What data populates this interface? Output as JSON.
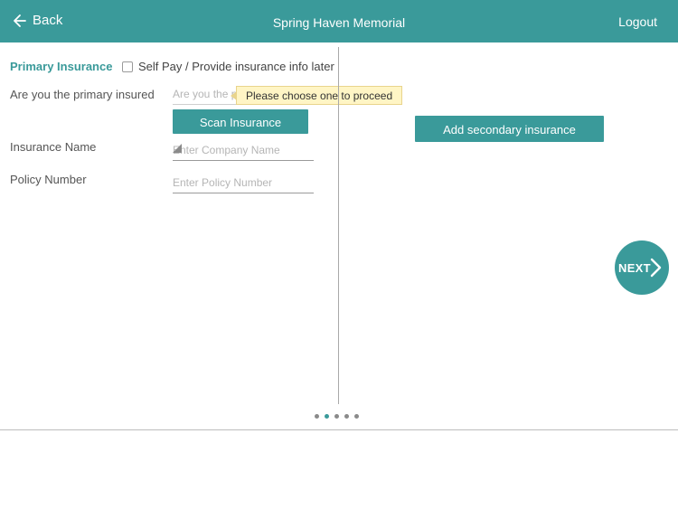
{
  "header": {
    "back_label": "Back",
    "title": "Spring Haven Memorial",
    "logout_label": "Logout"
  },
  "primary": {
    "section_title": "Primary Insurance",
    "self_pay_label": "Self Pay / Provide insurance info later",
    "self_pay_checked": false,
    "primary_insured_label": "Are you the primary insured",
    "primary_insured_placeholder": "Are you the primary insured",
    "tooltip": "Please choose one to proceed",
    "scan_button": "Scan Insurance",
    "insurance_name_label": "Insurance Name",
    "insurance_name_placeholder": "Enter Company Name",
    "policy_number_label": "Policy Number",
    "policy_number_placeholder": "Enter Policy Number"
  },
  "secondary": {
    "add_button": "Add secondary insurance"
  },
  "next_label": "NEXT",
  "pager": {
    "total": 5,
    "active_index": 1
  },
  "colors": {
    "accent": "#3a9a9a",
    "tooltip_bg": "#fff5c5"
  }
}
